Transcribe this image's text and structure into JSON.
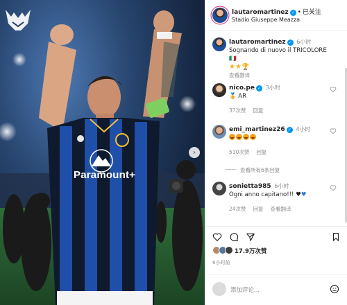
{
  "post": {
    "username": "lautaromartinez",
    "follow_state": "已关注",
    "location": "Stadio Giuseppe Meazza",
    "caption_time": "6小时",
    "caption": "Sognando di nuovo il TRICOLORE 🇮🇹",
    "translate_label": "查看翻译",
    "likes": "17.9万次赞",
    "posted_ago": "6小时前",
    "add_comment_placeholder": "添加评论...",
    "sponsor_text": "Paramount+"
  },
  "comments": [
    {
      "username": "nico.pe",
      "time": "3小时",
      "text": "AR",
      "likes": "37次赞",
      "reply": "回复"
    },
    {
      "username": "emi_martinez26",
      "time": "4小时",
      "text": "",
      "likes": "510次赞",
      "reply": "回复",
      "view_replies": "查看所有6条回复"
    },
    {
      "username": "sonietta985",
      "time": "6小时",
      "text": "Ogni anno capitano!!!",
      "likes": "24次赞",
      "reply": "回复",
      "translate": "查看翻译"
    }
  ],
  "icons": [
    "logo-icon",
    "next-arrow-icon",
    "verified-icon",
    "more-icon",
    "heart-icon",
    "comment-icon",
    "share-icon",
    "save-icon",
    "emoji-icon"
  ],
  "colors": {
    "verified": "#0095f6",
    "jersey_blue": "#1f4fa8",
    "text": "#262626",
    "muted": "#8e8e8e"
  }
}
